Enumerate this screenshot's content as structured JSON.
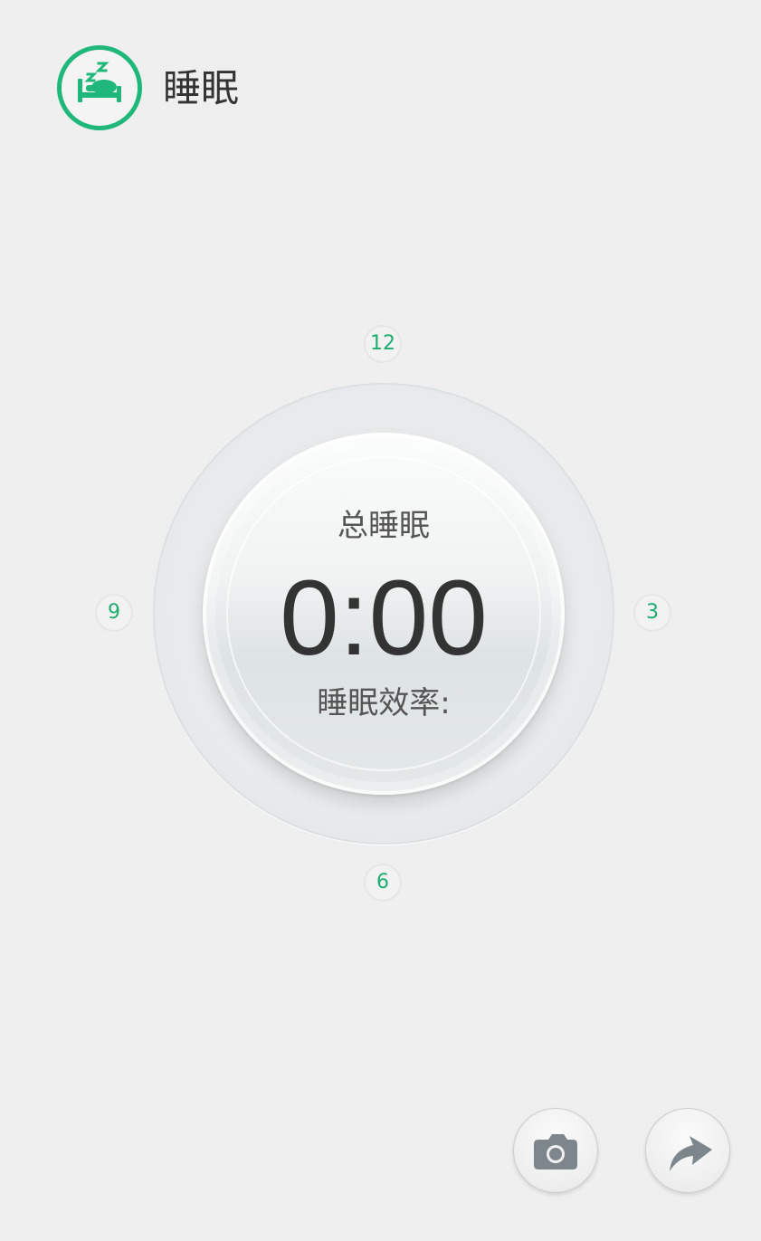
{
  "header": {
    "title": "睡眠",
    "icon": "sleep-bed-icon",
    "accent_color": "#1fb77a"
  },
  "dial": {
    "hour_markers": [
      "12",
      "3",
      "6",
      "9"
    ],
    "total_label": "总睡眠",
    "total_value": "0:00",
    "efficiency_label": "睡眠效率:"
  },
  "actions": {
    "camera_icon": "camera-icon",
    "share_icon": "share-arrow-icon"
  }
}
